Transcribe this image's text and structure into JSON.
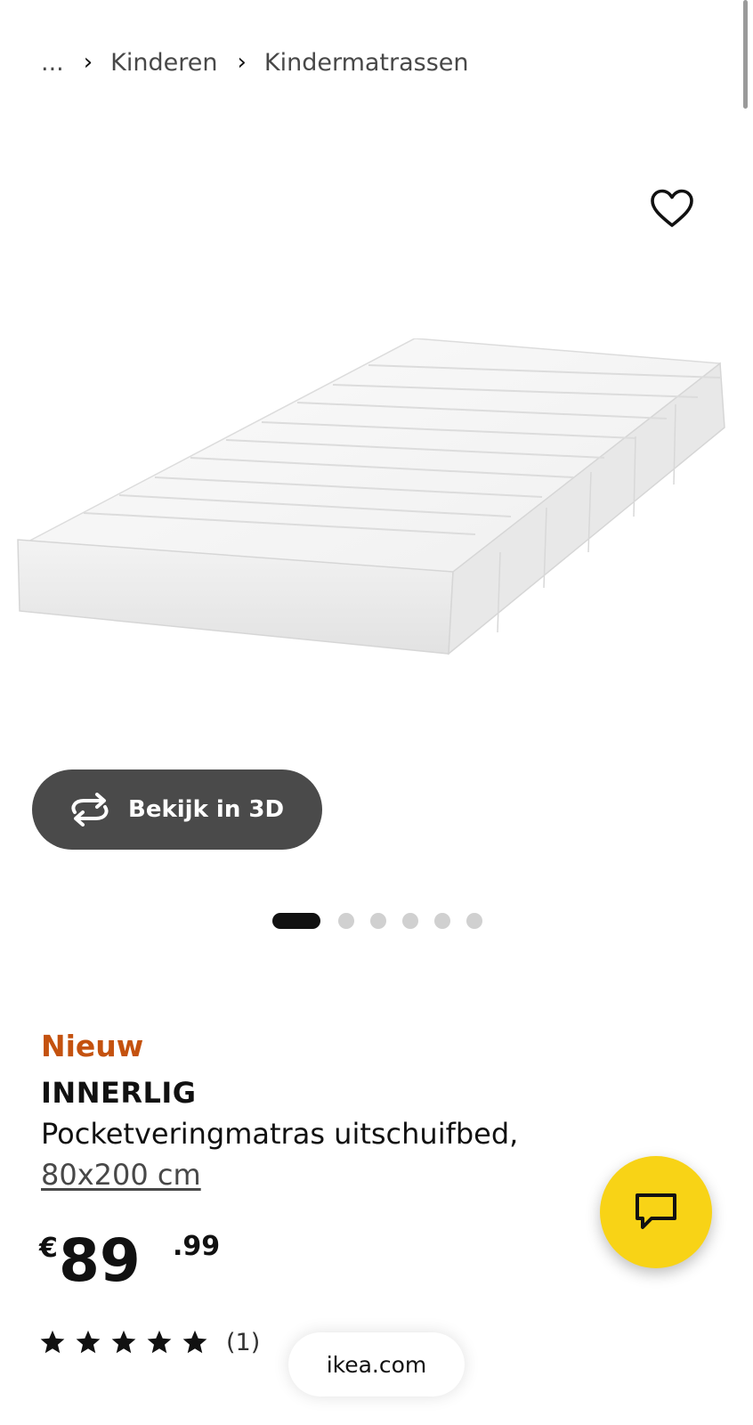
{
  "breadcrumb": {
    "ellipsis": "...",
    "items": [
      {
        "label": "Kinderen"
      },
      {
        "label": "Kindermatrassen"
      }
    ]
  },
  "gallery": {
    "favorite_icon": "heart-outline-icon",
    "view_3d_label": "Bekijk in 3D",
    "view_3d_icon": "rotate-arrows-icon",
    "total_images": 6,
    "active_image": 1
  },
  "product": {
    "badge": "Nieuw",
    "name": "INNERLIG",
    "description": "Pocketveringmatras uitschuifbed,",
    "size": "80x200 cm",
    "price": {
      "currency": "€",
      "integer": "89",
      "decimals": ".99"
    },
    "rating": {
      "stars": 5,
      "count": "(1)"
    }
  },
  "chat": {
    "icon": "chat-bubble-icon"
  },
  "browser": {
    "domain": "ikea.com"
  },
  "colors": {
    "badge": "#c4520f",
    "chat_button": "#f8d316",
    "view_3d_button": "#4a4a4a"
  }
}
